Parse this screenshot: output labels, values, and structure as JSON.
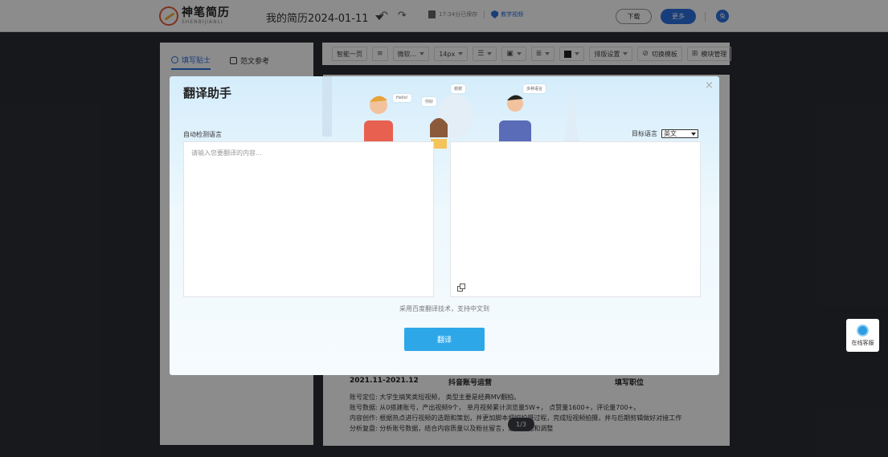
{
  "app": {
    "logo_cn": "神笔简历",
    "logo_en": "SHENBIJIANLI",
    "doc_title": "我的简历2024-01-11",
    "save_status": "17:34分已保存",
    "tutorial": "教学视频",
    "download": "下载",
    "more": "更多",
    "avatar_letter": "兔"
  },
  "left_panel": {
    "tabs": [
      {
        "label": "填写贴士",
        "active": true
      },
      {
        "label": "范文参考",
        "active": false
      }
    ]
  },
  "toolbar": {
    "items": [
      "智能一页",
      "微软...",
      "14px",
      "排版设置",
      "切换模板",
      "模块管理"
    ]
  },
  "resume": {
    "date": "2021.11-2021.12",
    "company": "抖音账号运营",
    "position": "填写职位",
    "lines": [
      "账号定位: 大学生搞笑类短视频， 类型主要是经典MV翻拍。",
      "账号数据: 从0搭建账号，产出视频9个， 单月视频累计浏览量5W+， 点赞量1600+，评论量700+。",
      "内容创作: 根据热点进行视频的选题和策划，并更加脚本把控拍摄过程，完成短视频拍摄，并与后期剪辑做好对接工作",
      "分析复盘: 分析账号数据，结合内容质量以及粉丝留言，进行优化和调整"
    ],
    "page_indicator": "1/3"
  },
  "service": {
    "label": "在线客服"
  },
  "modal": {
    "title": "翻译助手",
    "close": "×",
    "bubbles": [
      "Hello!",
      "你好",
      "谢谢",
      "多种语言"
    ],
    "source_label": "自动检测语言",
    "target_label": "目标语言",
    "target_value": "英文",
    "source_placeholder": "请输入您要翻译的内容...",
    "note": "采用百度翻译技术，支持中文到",
    "translate_button": "翻译"
  }
}
